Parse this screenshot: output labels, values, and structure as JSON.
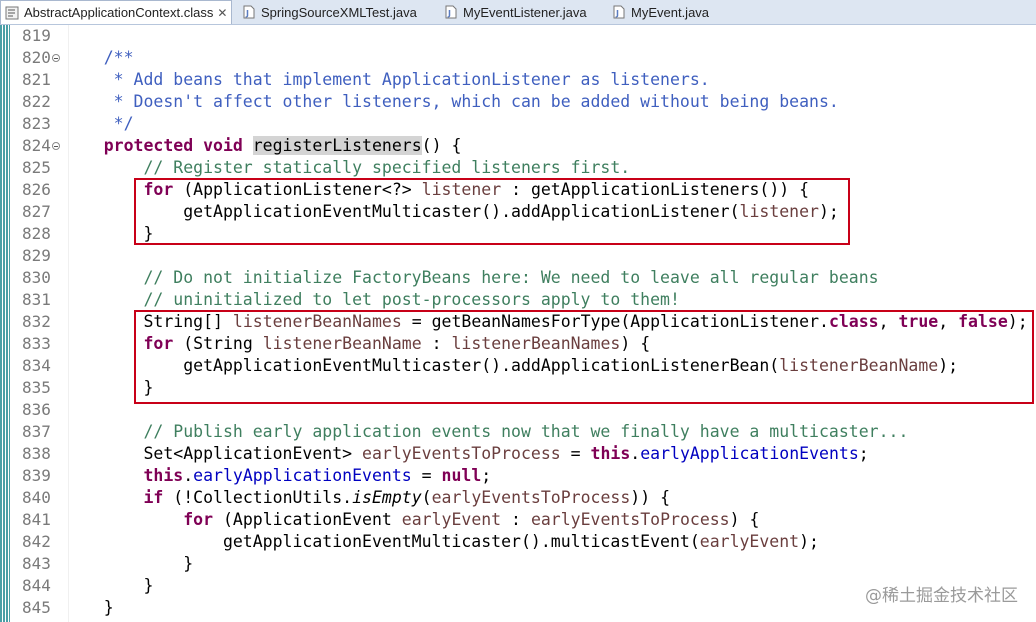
{
  "tabs": [
    {
      "label": "AbstractApplicationContext.class",
      "icon": "class-file-icon",
      "active": true,
      "close": "✕"
    },
    {
      "label": "SpringSourceXMLTest.java",
      "icon": "java-file-icon",
      "active": false
    },
    {
      "label": "MyEventListener.java",
      "icon": "java-file-icon",
      "active": false
    },
    {
      "label": "MyEvent.java",
      "icon": "java-file-icon",
      "active": false
    }
  ],
  "editor": {
    "lines": [
      {
        "n": "819"
      },
      {
        "n": "820"
      },
      {
        "n": "821"
      },
      {
        "n": "822"
      },
      {
        "n": "823"
      },
      {
        "n": "824"
      },
      {
        "n": "825"
      },
      {
        "n": "826"
      },
      {
        "n": "827"
      },
      {
        "n": "828"
      },
      {
        "n": "829"
      },
      {
        "n": "830"
      },
      {
        "n": "831"
      },
      {
        "n": "832"
      },
      {
        "n": "833"
      },
      {
        "n": "834"
      },
      {
        "n": "835"
      },
      {
        "n": "836"
      },
      {
        "n": "837"
      },
      {
        "n": "838"
      },
      {
        "n": "839"
      },
      {
        "n": "840"
      },
      {
        "n": "841"
      },
      {
        "n": "842"
      },
      {
        "n": "843"
      },
      {
        "n": "844"
      },
      {
        "n": "845"
      }
    ],
    "code": {
      "l820": "    /**",
      "l821": "     * Add beans that implement ApplicationListener as listeners.",
      "l822": "     * Doesn't affect other listeners, which can be added without being beans.",
      "l823": "     */",
      "l824_kw": "    protected void ",
      "l824_sel": "registerListeners",
      "l824_rest": "() {",
      "l825": "        // Register statically specified listeners first.",
      "l826_kw": "for",
      "l826_a": " (ApplicationListener<?> ",
      "l826_var": "listener",
      "l826_b": " : getApplicationListeners()) {",
      "l827_a": "            getApplicationEventMulticaster().addApplicationListener(",
      "l827_var": "listener",
      "l827_b": ");",
      "l828": "        }",
      "l830": "        // Do not initialize FactoryBeans here: We need to leave all regular beans",
      "l831": "        // uninitialized to let post-processors apply to them!",
      "l832_a": "        String[] ",
      "l832_var": "listenerBeanNames",
      "l832_b": " = getBeanNamesForType(ApplicationListener.",
      "l832_kw1": "class",
      "l832_c": ", ",
      "l832_kw2": "true",
      "l832_d": ", ",
      "l832_kw3": "false",
      "l832_e": ");",
      "l833_kw": "for",
      "l833_a": " (String ",
      "l833_var1": "listenerBeanName",
      "l833_b": " : ",
      "l833_var2": "listenerBeanNames",
      "l833_c": ") {",
      "l834_a": "            getApplicationEventMulticaster().addApplicationListenerBean(",
      "l834_var": "listenerBeanName",
      "l834_b": ");",
      "l835": "        }",
      "l837": "        // Publish early application events now that we finally have a multicaster...",
      "l838_a": "        Set<ApplicationEvent> ",
      "l838_var": "earlyEventsToProcess",
      "l838_b": " = ",
      "l838_kw": "this",
      "l838_c": ".",
      "l838_fld": "earlyApplicationEvents",
      "l838_d": ";",
      "l839_kw1": "this",
      "l839_a": ".",
      "l839_fld": "earlyApplicationEvents",
      "l839_b": " = ",
      "l839_kw2": "null",
      "l839_c": ";",
      "l840_kw": "if",
      "l840_a": " (!CollectionUtils.",
      "l840_it": "isEmpty",
      "l840_b": "(",
      "l840_var": "earlyEventsToProcess",
      "l840_c": ")) {",
      "l841_kw": "for",
      "l841_a": " (ApplicationEvent ",
      "l841_var1": "earlyEvent",
      "l841_b": " : ",
      "l841_var2": "earlyEventsToProcess",
      "l841_c": ") {",
      "l842_a": "                getApplicationEventMulticaster().multicastEvent(",
      "l842_var": "earlyEvent",
      "l842_b": ");",
      "l843": "            }",
      "l844": "        }",
      "l845": "    }"
    }
  },
  "watermark": "@稀土掘金技术社区",
  "colors": {
    "keyword": "#7f0055",
    "javadoc": "#3f5fbf",
    "comment": "#3f7f5f",
    "field": "#0000c0",
    "local_variable": "#6a3e3e",
    "highlight_box": "#c80018"
  }
}
